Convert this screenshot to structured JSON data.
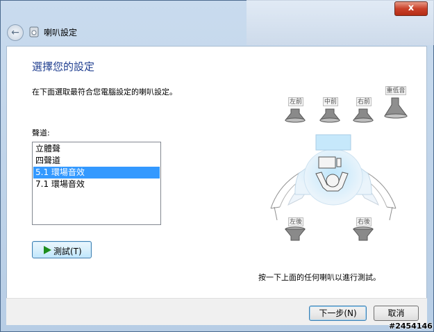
{
  "window": {
    "title": "喇叭設定",
    "close_label": "x"
  },
  "header": {
    "back_icon": "back-arrow-icon"
  },
  "main": {
    "heading": "選擇您的設定",
    "instruction": "在下面選取最符合您電腦設定的喇叭設定。",
    "channels_label": "聲道:",
    "channels": [
      {
        "label": "立體聲",
        "selected": false
      },
      {
        "label": "四聲道",
        "selected": false
      },
      {
        "label": "5.1 環場音效",
        "selected": true
      },
      {
        "label": "7.1 環場音效",
        "selected": false
      }
    ],
    "test_button_label": "測試(T)",
    "hint": "按一下上面的任何喇叭以進行測試。"
  },
  "speakers": {
    "front_left": "左前",
    "center": "中前",
    "front_right": "右前",
    "subwoofer": "重低音",
    "rear_left": "左後",
    "rear_right": "右後"
  },
  "footer": {
    "next_label": "下一步(N)",
    "cancel_label": "取消"
  },
  "watermark": "#2454146",
  "colors": {
    "heading": "#1e3d8f",
    "selection": "#3399ff",
    "play": "#1d8d1d"
  }
}
